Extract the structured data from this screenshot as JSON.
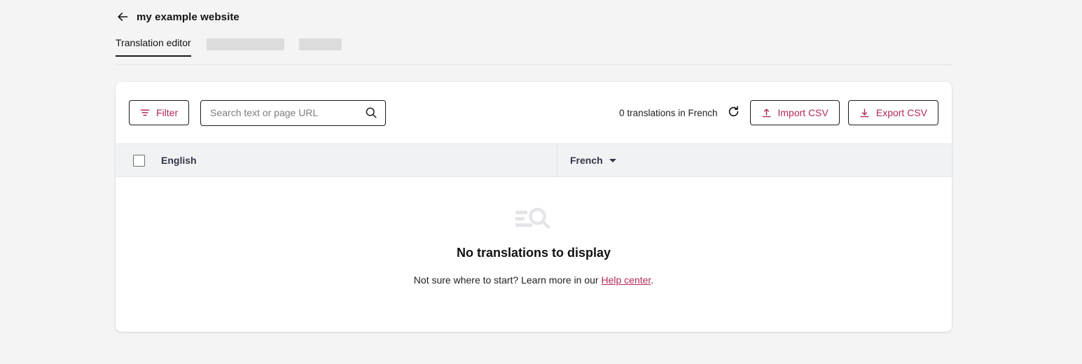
{
  "header": {
    "back_icon": "arrow-left-icon",
    "title": "my example website"
  },
  "tabs": [
    {
      "label": "Translation editor",
      "active": true
    },
    {
      "label": "",
      "skeleton": true
    },
    {
      "label": "",
      "skeleton": true
    }
  ],
  "toolbar": {
    "filter_label": "Filter",
    "filter_icon": "filter-icon",
    "search_placeholder": "Search text or page URL",
    "search_value": "",
    "search_icon": "search-icon",
    "count_label": "0 translations in French",
    "refresh_icon": "refresh-icon",
    "import_label": "Import CSV",
    "import_icon": "upload-icon",
    "export_label": "Export CSV",
    "export_icon": "download-icon"
  },
  "table": {
    "select_all_checked": false,
    "columns": [
      {
        "label": "English",
        "sortable": false
      },
      {
        "label": "French",
        "sortable": true
      }
    ]
  },
  "empty_state": {
    "icon": "list-search-icon",
    "title": "No translations to display",
    "subtitle_before": "Not sure where to start? Learn more in our ",
    "link_label": "Help center",
    "subtitle_after": "."
  },
  "colors": {
    "accent": "#b4285a",
    "page_background": "#f4f4f4",
    "card_background": "#ffffff",
    "table_header_background": "#f1f2f3",
    "empty_icon": "#e3e5e8",
    "text_primary": "#111214",
    "text_secondary": "#7a7d82"
  }
}
